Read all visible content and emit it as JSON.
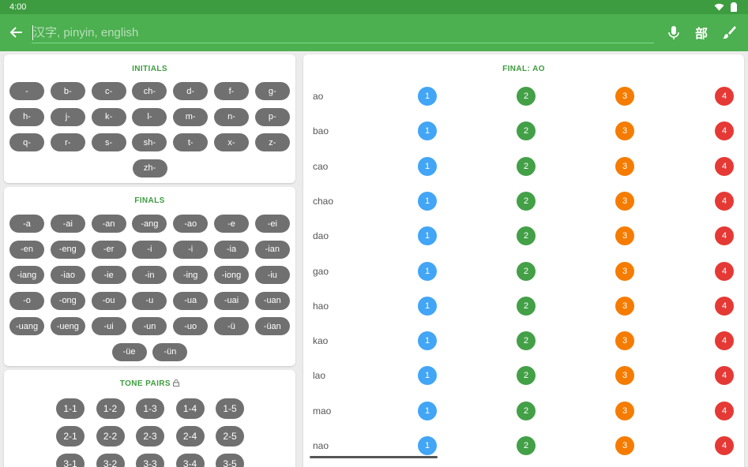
{
  "status": {
    "time": "4:00"
  },
  "search": {
    "placeholder": "汉字, pinyin, english",
    "value": "",
    "radical_label": "部"
  },
  "initials": {
    "title": "INITIALS",
    "items": [
      "-",
      "b-",
      "c-",
      "ch-",
      "d-",
      "f-",
      "g-",
      "h-",
      "j-",
      "k-",
      "l-",
      "m-",
      "n-",
      "p-",
      "q-",
      "r-",
      "s-",
      "sh-",
      "t-",
      "x-",
      "z-",
      "zh-"
    ]
  },
  "finals": {
    "title": "FINALS",
    "items": [
      "-a",
      "-ai",
      "-an",
      "-ang",
      "-ao",
      "-e",
      "-ei",
      "-en",
      "-eng",
      "-er",
      "-i",
      "-i",
      "-ia",
      "-ian",
      "-iang",
      "-iao",
      "-ie",
      "-in",
      "-ing",
      "-iong",
      "-iu",
      "-o",
      "-ong",
      "-ou",
      "-u",
      "-ua",
      "-uai",
      "-uan",
      "-uang",
      "-ueng",
      "-ui",
      "-un",
      "-uo",
      "-ü",
      "-üan",
      "-üe",
      "-ün"
    ]
  },
  "tone_pairs": {
    "title": "TONE PAIRS",
    "items": [
      "1-1",
      "1-2",
      "1-3",
      "1-4",
      "1-5",
      "2-1",
      "2-2",
      "2-3",
      "2-4",
      "2-5",
      "3-1",
      "3-2",
      "3-3",
      "3-4",
      "3-5"
    ]
  },
  "final_panel": {
    "title": "FINAL: AO",
    "tone_labels": [
      "1",
      "2",
      "3",
      "4"
    ],
    "rows": [
      "ao",
      "bao",
      "cao",
      "chao",
      "dao",
      "gao",
      "hao",
      "kao",
      "lao",
      "mao",
      "nao"
    ]
  },
  "colors": {
    "appbar": "#4caf50",
    "statusbar": "#3d9c3f",
    "tone1": "#42a5f5",
    "tone2": "#43a047",
    "tone3": "#f57c00",
    "tone4": "#e53935"
  },
  "icons": {
    "back": "arrow-left-icon",
    "mic": "microphone-icon",
    "brush": "brush-icon",
    "lock": "lock-icon"
  }
}
